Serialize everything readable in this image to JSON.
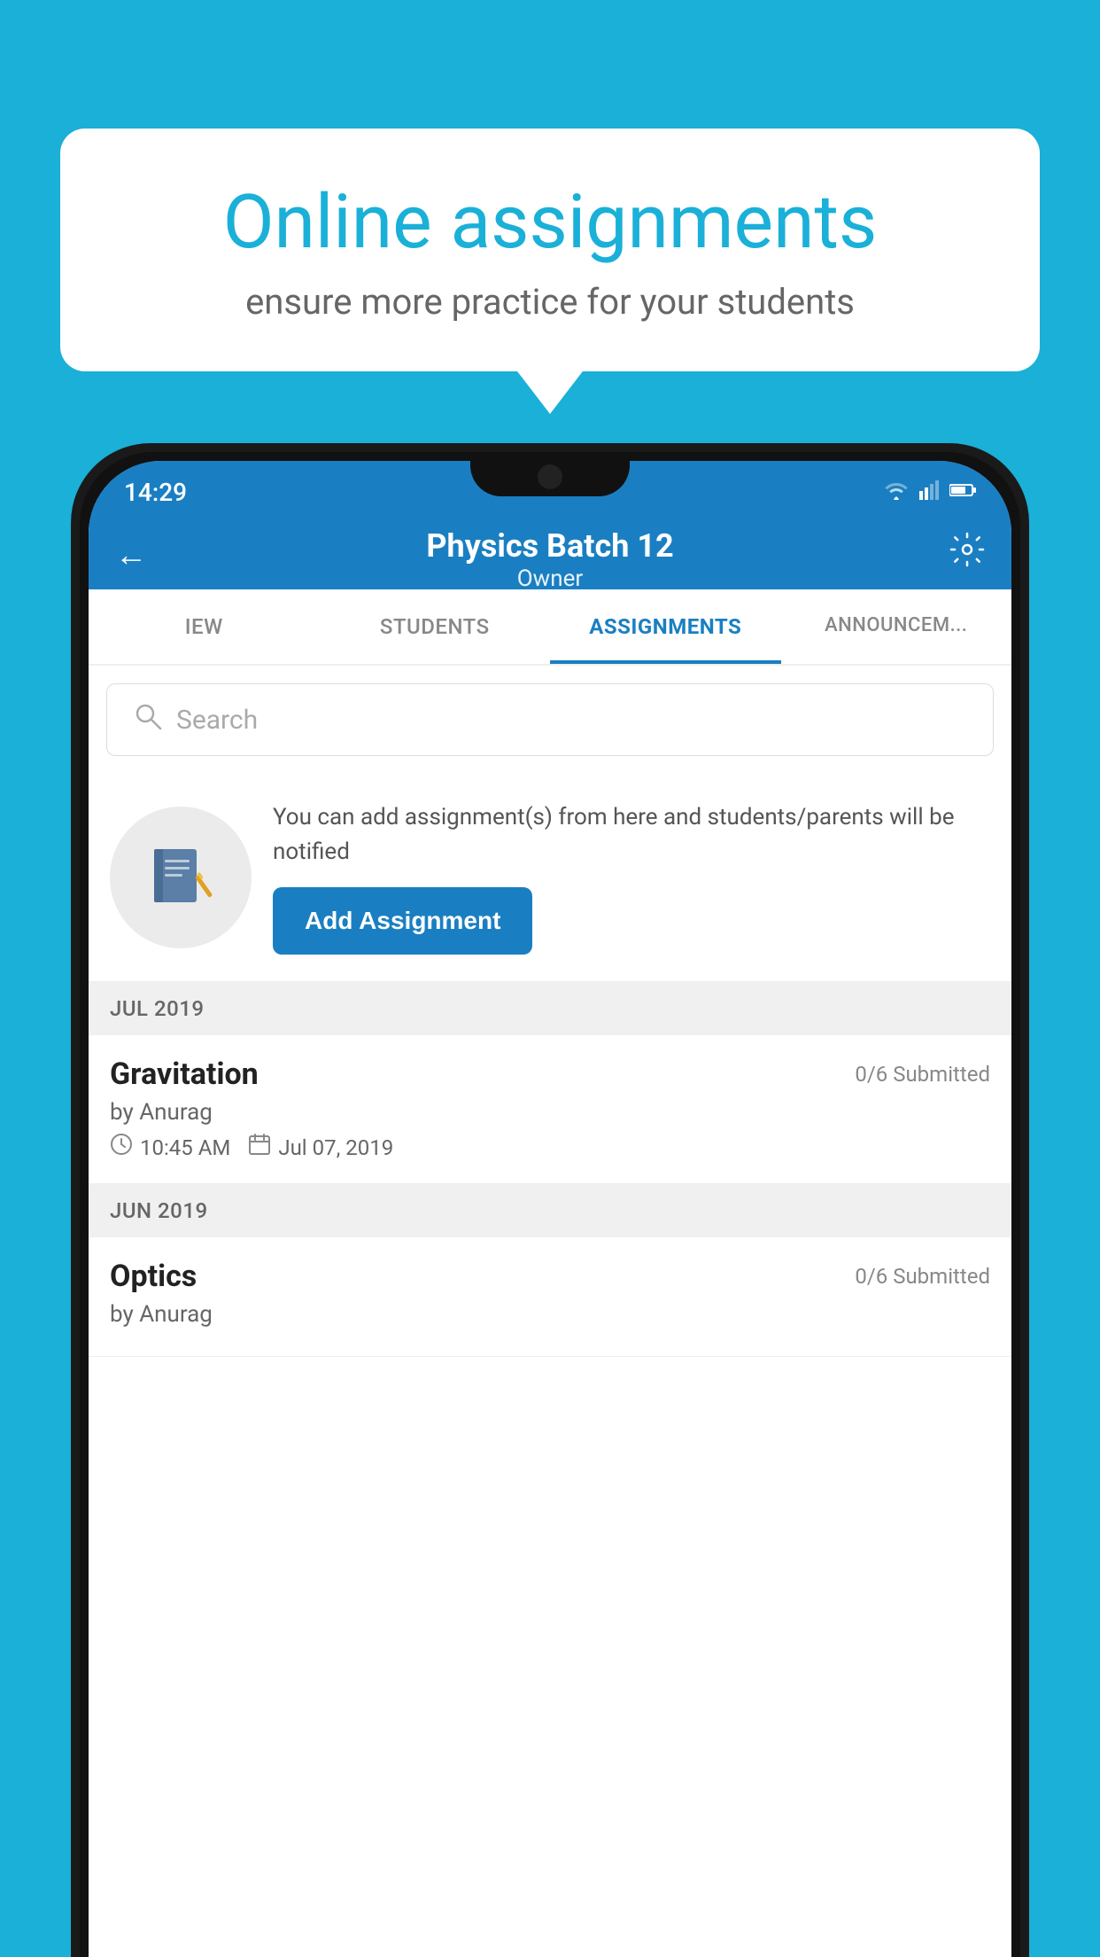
{
  "background_color": "#1ab0d8",
  "bubble": {
    "title": "Online assignments",
    "subtitle": "ensure more practice for your students"
  },
  "phone": {
    "status_bar": {
      "time": "14:29",
      "wifi": "▼",
      "signal": "▲",
      "battery": "▮"
    },
    "header": {
      "title": "Physics Batch 12",
      "subtitle": "Owner",
      "back_label": "←",
      "settings_label": "⚙"
    },
    "tabs": [
      {
        "label": "IEW",
        "active": false
      },
      {
        "label": "STUDENTS",
        "active": false
      },
      {
        "label": "ASSIGNMENTS",
        "active": true
      },
      {
        "label": "ANNOUNCEM...",
        "active": false
      }
    ],
    "search": {
      "placeholder": "Search"
    },
    "promo": {
      "text": "You can add assignment(s) from here and students/parents will be notified",
      "button_label": "Add Assignment"
    },
    "sections": [
      {
        "month": "JUL 2019",
        "assignments": [
          {
            "name": "Gravitation",
            "submitted": "0/6 Submitted",
            "by": "by Anurag",
            "time": "10:45 AM",
            "date": "Jul 07, 2019"
          }
        ]
      },
      {
        "month": "JUN 2019",
        "assignments": [
          {
            "name": "Optics",
            "submitted": "0/6 Submitted",
            "by": "by Anurag",
            "time": "",
            "date": ""
          }
        ]
      }
    ]
  }
}
